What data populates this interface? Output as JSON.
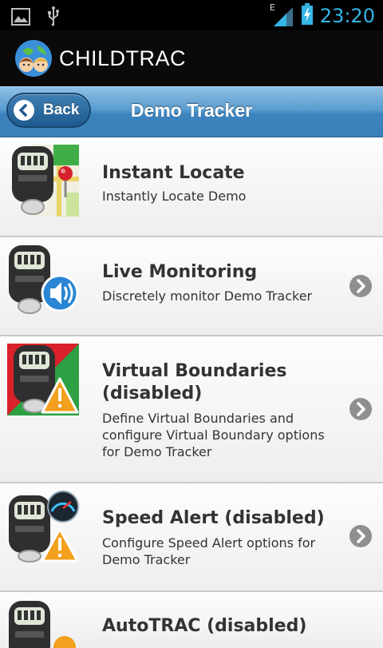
{
  "status_bar": {
    "time": "23:20",
    "network_label": "E",
    "icons": [
      "image-icon",
      "usb-icon",
      "signal-icon",
      "battery-charging-icon"
    ],
    "accent_color": "#33b5e5"
  },
  "app": {
    "title": "CHILDTRAC",
    "logo_icon": "childtrac-globe-logo"
  },
  "nav": {
    "back_label": "Back",
    "title": "Demo Tracker",
    "bar_color": "#4a8fc6"
  },
  "list": {
    "items": [
      {
        "title": "Instant Locate",
        "subtitle": "Instantly Locate Demo",
        "icon": "tracker-map-pin-icon",
        "chevron": false
      },
      {
        "title": "Live Monitoring",
        "subtitle": "Discretely monitor Demo Tracker",
        "icon": "tracker-speaker-icon",
        "chevron": true
      },
      {
        "title_line1": "Virtual Boundaries",
        "title_line2": "(disabled)",
        "subtitle_line1": "Define Virtual Boundaries and",
        "subtitle_line2": "configure Virtual Boundary options",
        "subtitle_line3": "for Demo Tracker",
        "icon": "tracker-boundary-warning-icon",
        "chevron": true
      },
      {
        "title": "Speed Alert (disabled)",
        "subtitle_line1": "Configure Speed Alert options for",
        "subtitle_line2": "Demo Tracker",
        "icon": "tracker-speedometer-warning-icon",
        "chevron": true
      },
      {
        "title": "AutoTRAC (disabled)",
        "icon": "tracker-auto-icon",
        "chevron": false
      }
    ]
  }
}
